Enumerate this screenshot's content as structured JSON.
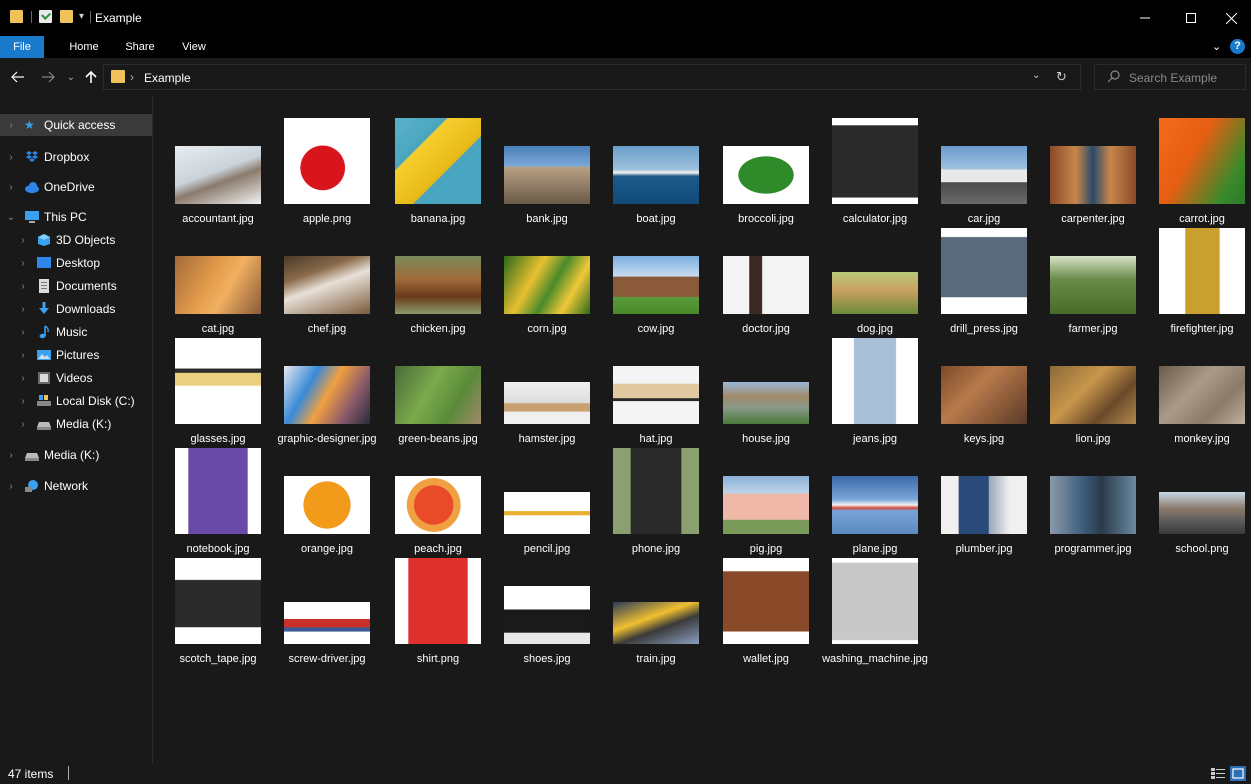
{
  "window": {
    "title": "Example",
    "minimize_icon": "minimize-icon",
    "maximize_icon": "maximize-icon",
    "close_icon": "close-icon"
  },
  "ribbon": {
    "tabs": [
      "File",
      "Home",
      "Share",
      "View"
    ]
  },
  "address": {
    "crumb": "Example",
    "search_placeholder": "Search Example"
  },
  "nav": {
    "items": [
      {
        "label": "Quick access",
        "icon": "star-icon"
      },
      {
        "label": "Dropbox",
        "icon": "dropbox-icon"
      },
      {
        "label": "OneDrive",
        "icon": "cloud-icon"
      },
      {
        "label": "This PC",
        "icon": "pc-icon"
      },
      {
        "label": "3D Objects",
        "icon": "cube-icon"
      },
      {
        "label": "Desktop",
        "icon": "desktop-icon"
      },
      {
        "label": "Documents",
        "icon": "documents-icon"
      },
      {
        "label": "Downloads",
        "icon": "download-icon"
      },
      {
        "label": "Music",
        "icon": "music-icon"
      },
      {
        "label": "Pictures",
        "icon": "pictures-icon"
      },
      {
        "label": "Videos",
        "icon": "videos-icon"
      },
      {
        "label": "Local Disk (C:)",
        "icon": "local-disk-icon"
      },
      {
        "label": "Media (K:)",
        "icon": "drive-icon"
      },
      {
        "label": "Media (K:)",
        "icon": "drive-icon"
      },
      {
        "label": "Network",
        "icon": "network-icon"
      }
    ]
  },
  "files": [
    {
      "name": "accountant.jpg"
    },
    {
      "name": "apple.png"
    },
    {
      "name": "banana.jpg"
    },
    {
      "name": "bank.jpg"
    },
    {
      "name": "boat.jpg"
    },
    {
      "name": "broccoli.jpg"
    },
    {
      "name": "calculator.jpg"
    },
    {
      "name": "car.jpg"
    },
    {
      "name": "carpenter.jpg"
    },
    {
      "name": "carrot.jpg"
    },
    {
      "name": "cat.jpg"
    },
    {
      "name": "chef.jpg"
    },
    {
      "name": "chicken.jpg"
    },
    {
      "name": "corn.jpg"
    },
    {
      "name": "cow.jpg"
    },
    {
      "name": "doctor.jpg"
    },
    {
      "name": "dog.jpg"
    },
    {
      "name": "drill_press.jpg"
    },
    {
      "name": "farmer.jpg"
    },
    {
      "name": "firefighter.jpg"
    },
    {
      "name": "glasses.jpg"
    },
    {
      "name": "graphic-designer.jpg"
    },
    {
      "name": "green-beans.jpg"
    },
    {
      "name": "hamster.jpg"
    },
    {
      "name": "hat.jpg"
    },
    {
      "name": "house.jpg"
    },
    {
      "name": "jeans.jpg"
    },
    {
      "name": "keys.jpg"
    },
    {
      "name": "lion.jpg"
    },
    {
      "name": "monkey.jpg"
    },
    {
      "name": "notebook.jpg"
    },
    {
      "name": "orange.jpg"
    },
    {
      "name": "peach.jpg"
    },
    {
      "name": "pencil.jpg"
    },
    {
      "name": "phone.jpg"
    },
    {
      "name": "pig.jpg"
    },
    {
      "name": "plane.jpg"
    },
    {
      "name": "plumber.jpg"
    },
    {
      "name": "programmer.jpg"
    },
    {
      "name": "school.png"
    },
    {
      "name": "scotch_tape.jpg"
    },
    {
      "name": "screw-driver.jpg"
    },
    {
      "name": "shirt.png"
    },
    {
      "name": "shoes.jpg"
    },
    {
      "name": "train.jpg"
    },
    {
      "name": "wallet.jpg"
    },
    {
      "name": "washing_machine.jpg"
    }
  ],
  "status": {
    "count": "47 items"
  }
}
